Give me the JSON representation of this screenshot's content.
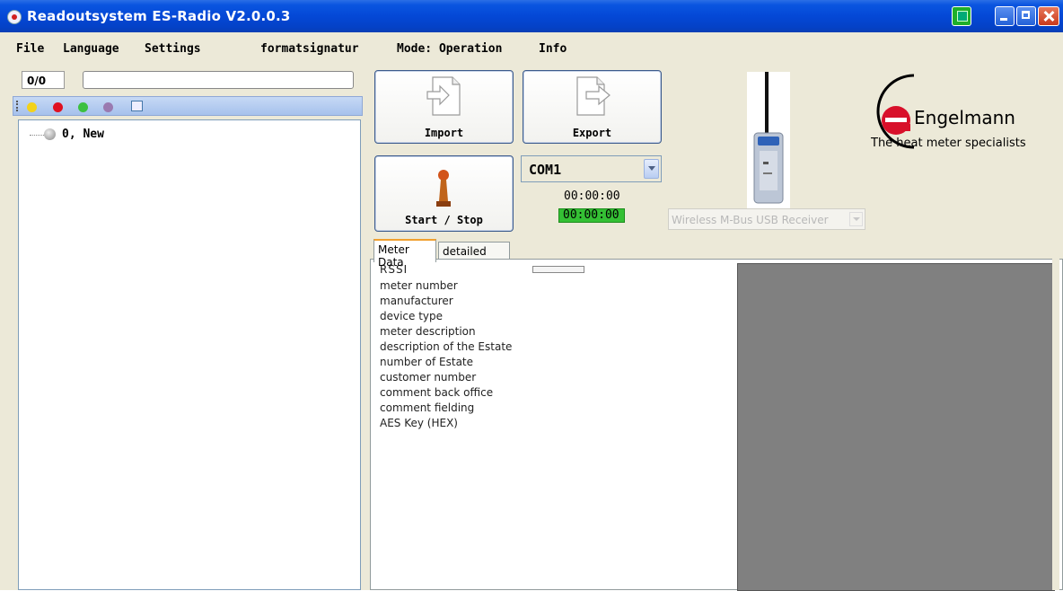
{
  "window": {
    "title": "Readoutsystem ES-Radio V2.0.0.3"
  },
  "menu": {
    "items": [
      "File",
      "Language",
      "Settings",
      "formatsignatur",
      "Mode: Operation",
      "Info"
    ]
  },
  "left_panel": {
    "counter": "0/0",
    "search_value": "",
    "filter_dots": [
      "#f3d21a",
      "#e01020",
      "#3cc040",
      "#9a7ab0"
    ],
    "tree": {
      "root_label": "0, New"
    }
  },
  "toolbar": {
    "import_label": "Import",
    "export_label": "Export",
    "start_stop_label": "Start / Stop",
    "com_port": "COM1",
    "timer_elapsed": "00:00:00",
    "timer_status": "00:00:00",
    "receiver_select": "Wireless M-Bus USB Receiver"
  },
  "branding": {
    "company": "Engelmann",
    "tagline": "The heat meter specialists"
  },
  "tabs": [
    "Meter Data",
    "detailed Info"
  ],
  "meter_data_fields": [
    "RSSI",
    "meter number",
    "manufacturer",
    "device type",
    "meter description",
    "description of the Estate",
    "number of Estate",
    "customer number",
    "comment back office",
    "comment fielding",
    "AES Key (HEX)"
  ]
}
